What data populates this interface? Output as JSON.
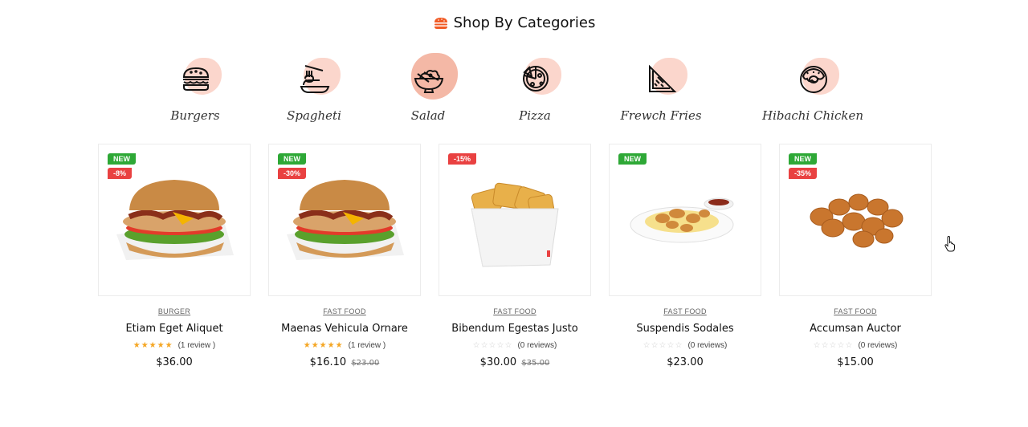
{
  "section": {
    "title": "Shop By Categories",
    "icon": "burger-icon",
    "accent": "#f15a24"
  },
  "categories": [
    {
      "label": "Burgers",
      "icon": "burger-icon"
    },
    {
      "label": "Spagheti",
      "icon": "noodles-icon"
    },
    {
      "label": "Salad",
      "icon": "salad-bowl-icon"
    },
    {
      "label": "Pizza",
      "icon": "pizza-icon"
    },
    {
      "label": "Frewch Fries",
      "icon": "sandwich-icon"
    },
    {
      "label": "Hibachi Chicken",
      "icon": "donut-icon"
    }
  ],
  "products": [
    {
      "category": "BURGER",
      "name": "Etiam Eget Aliquet",
      "badges": [
        "NEW",
        "-8%"
      ],
      "rating": 5,
      "reviews": "(1 review )",
      "price": "$36.00",
      "old_price": ""
    },
    {
      "category": "FAST FOOD",
      "name": "Maenas Vehicula Ornare",
      "badges": [
        "NEW",
        "-30%"
      ],
      "rating": 5,
      "reviews": "(1 review )",
      "price": "$16.10",
      "old_price": "$23.00"
    },
    {
      "category": "FAST FOOD",
      "name": "Bibendum Egestas Justo",
      "badges": [
        "-15%"
      ],
      "rating": 0,
      "reviews": "(0 reviews)",
      "price": "$30.00",
      "old_price": "$35.00"
    },
    {
      "category": "FAST FOOD",
      "name": "Suspendis Sodales",
      "badges": [
        "NEW"
      ],
      "rating": 0,
      "reviews": "(0 reviews)",
      "price": "$23.00",
      "old_price": ""
    },
    {
      "category": "FAST FOOD",
      "name": "Accumsan Auctor",
      "badges": [
        "NEW",
        "-35%"
      ],
      "rating": 0,
      "reviews": "(0 reviews)",
      "price": "$15.00",
      "old_price": ""
    }
  ],
  "colors": {
    "new_badge": "#2ea836",
    "sale_badge": "#e94141",
    "star": "#f5a623",
    "category_blob": "#fbd6cc"
  }
}
